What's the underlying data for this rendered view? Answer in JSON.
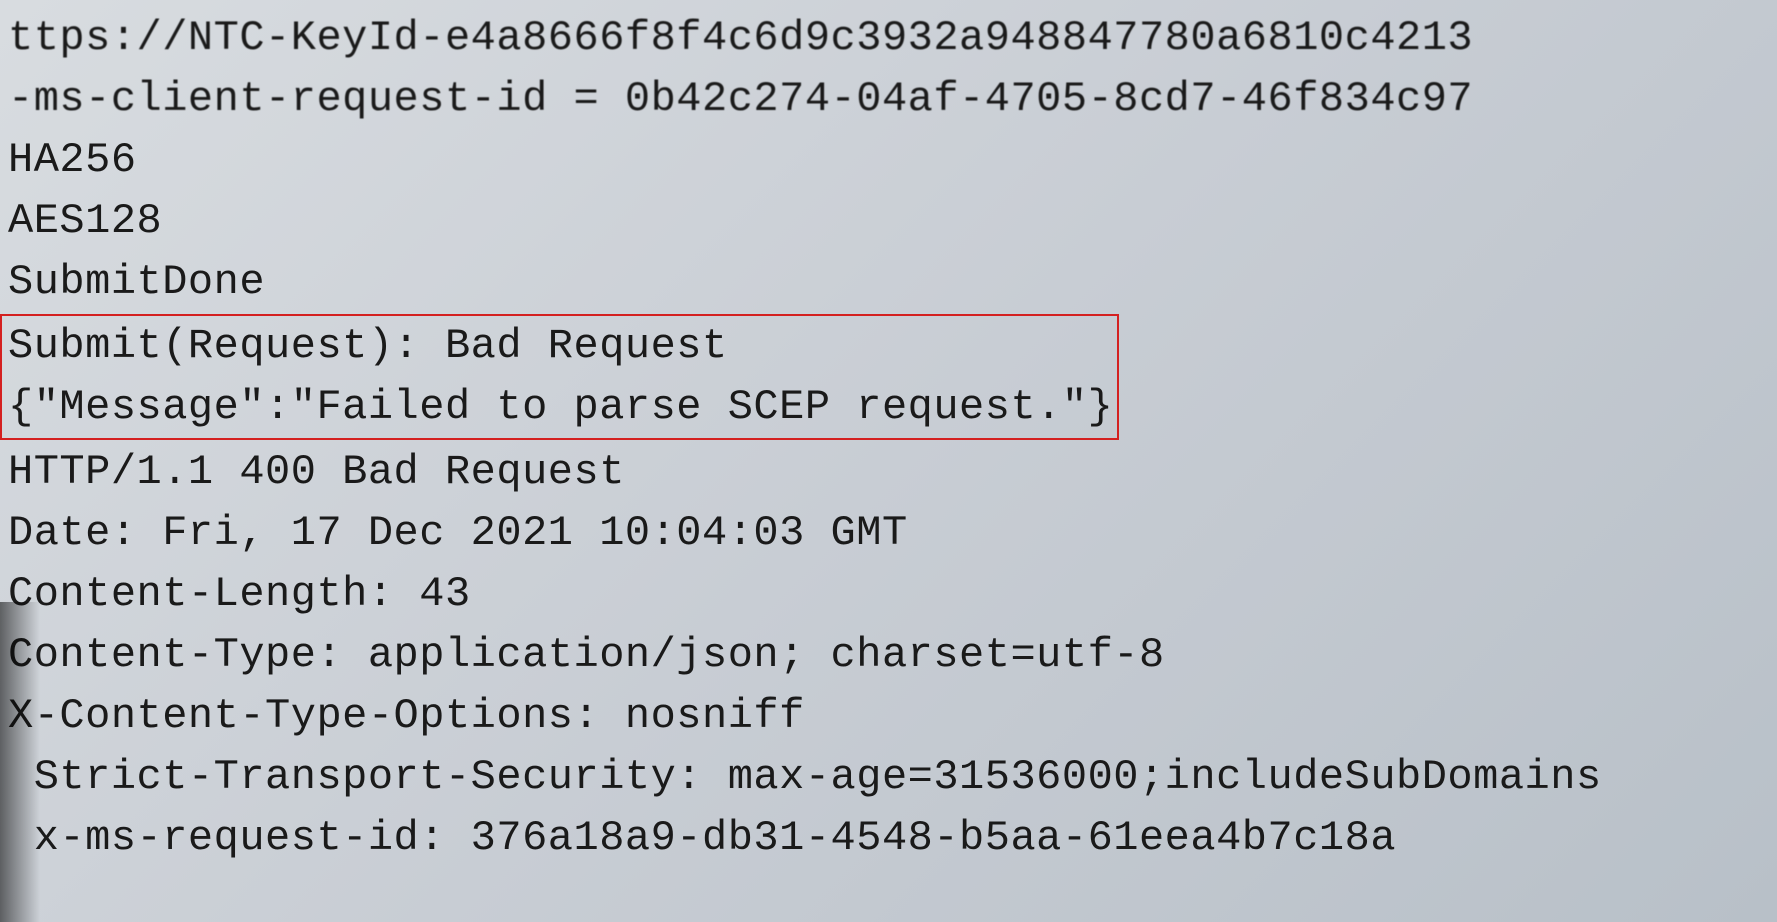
{
  "log": {
    "lines": [
      "ttps://NTC-KeyId-e4a8666f8f4c6d9c3932a948847780a6810c4213",
      "-ms-client-request-id = 0b42c274-04af-4705-8cd7-46f834c97",
      "HA256",
      "AES128",
      "SubmitDone"
    ],
    "error": {
      "line1": "Submit(Request): Bad Request",
      "line2": "{\"Message\":\"Failed to parse SCEP request.\"}"
    },
    "response": [
      "HTTP/1.1 400 Bad Request",
      "Date: Fri, 17 Dec 2021 10:04:03 GMT",
      "Content-Length: 43",
      "Content-Type: application/json; charset=utf-8",
      "X-Content-Type-Options: nosniff",
      " Strict-Transport-Security: max-age=31536000;includeSubDomains",
      " x-ms-request-id: 376a18a9-db31-4548-b5aa-61eea4b7c18a"
    ]
  }
}
